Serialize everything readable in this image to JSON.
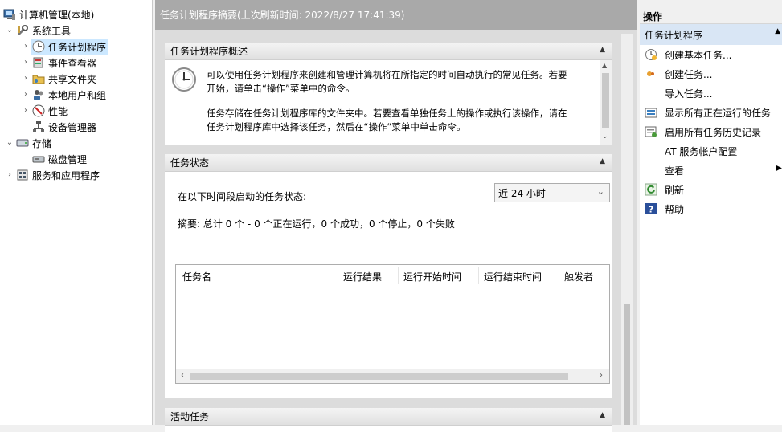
{
  "tree": {
    "root": "计算机管理(本地)",
    "system_tools": "系统工具",
    "task_scheduler": "任务计划程序",
    "event_viewer": "事件查看器",
    "shared_folders": "共享文件夹",
    "local_users": "本地用户和组",
    "performance": "性能",
    "device_manager": "设备管理器",
    "storage": "存储",
    "disk_management": "磁盘管理",
    "services_apps": "服务和应用程序"
  },
  "middle": {
    "header": "任务计划程序摘要(上次刷新时间: 2022/8/27 17:41:39)",
    "overview": {
      "title": "任务计划程序概述",
      "para1_line1": "可以使用任务计划程序来创建和管理计算机将在所指定的时间自动执行的常见任务。若要",
      "para1_line2": "开始，请单击“操作”菜单中的命令。",
      "para2_line1": "任务存储在任务计划程序库的文件夹中。若要查看单独任务上的操作或执行该操作，请在",
      "para2_line2": "任务计划程序库中选择该任务，然后在“操作”菜单中单击命令。"
    },
    "status": {
      "title": "任务状态",
      "range_label": "在以下时间段启动的任务状态:",
      "range_value": "近 24 小时",
      "summary": "摘要: 总计 0 个 - 0 个正在运行，0 个成功，0 个停止，0 个失败",
      "columns": [
        "任务名",
        "运行结果",
        "运行开始时间",
        "运行结束时间",
        "触发者"
      ]
    },
    "active": {
      "title": "活动任务"
    }
  },
  "actions": {
    "title": "操作",
    "group": "任务计划程序",
    "items": [
      "创建基本任务...",
      "创建任务...",
      "导入任务...",
      "显示所有正在运行的任务",
      "启用所有任务历史记录",
      "AT 服务帐户配置",
      "查看",
      "刷新",
      "帮助"
    ]
  }
}
